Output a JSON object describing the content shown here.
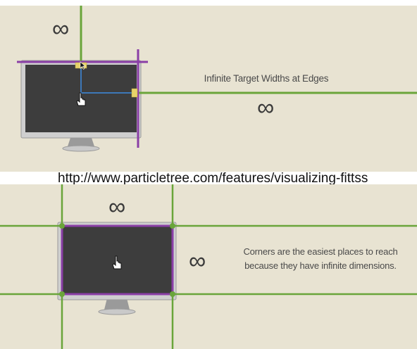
{
  "top_panel": {
    "title": "Infinite Target Widths at Edges",
    "symbols": [
      "∞",
      "∞"
    ]
  },
  "caption": "http://www.particletree.com/features/visualizing-fittss",
  "bottom_panel": {
    "text_line1": "Corners are the easiest places to reach",
    "text_line2": "because they have infinite dimensions.",
    "symbols": [
      "∞",
      "∞"
    ]
  },
  "colors": {
    "background": "#e8e3d2",
    "edge_line_green": "#6aa53a",
    "screen_border_purple": "#8a3fa6",
    "pointer_path_blue": "#3d78b8",
    "target_yellow": "#e6d36a",
    "screen_dark": "#3d3d3d"
  }
}
